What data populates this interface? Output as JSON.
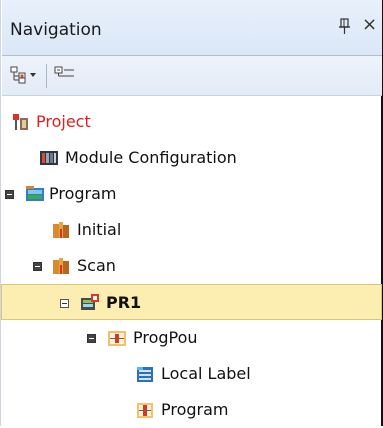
{
  "window": {
    "title": "Navigation",
    "pin_icon": "pin-icon",
    "close_symbol": "×"
  },
  "toolbar": {
    "buttons": [
      {
        "icon": "expand-tree-dropdown-icon"
      },
      {
        "icon": "collapse-tree-icon"
      }
    ]
  },
  "tree": {
    "items": [
      {
        "label": "Project",
        "icon": "project-icon",
        "color": "#e0201c"
      },
      {
        "label": "Module Configuration",
        "icon": "module-configuration-icon"
      },
      {
        "label": "Program",
        "icon": "program-folder-icon",
        "expanded": true
      },
      {
        "label": "Initial",
        "icon": "task-icon"
      },
      {
        "label": "Scan",
        "icon": "task-icon",
        "expanded": true
      },
      {
        "label": "PR1",
        "icon": "program-file-icon",
        "expanded": true,
        "selected": true
      },
      {
        "label": "ProgPou",
        "icon": "pou-icon",
        "expanded": true
      },
      {
        "label": "Local Label",
        "icon": "local-label-icon"
      },
      {
        "label": "Program",
        "icon": "program-body-icon"
      }
    ]
  },
  "colors": {
    "selection_bg": "#fbeeb0",
    "title_bg": "#dbe7f7",
    "project_text": "#e0201c"
  }
}
